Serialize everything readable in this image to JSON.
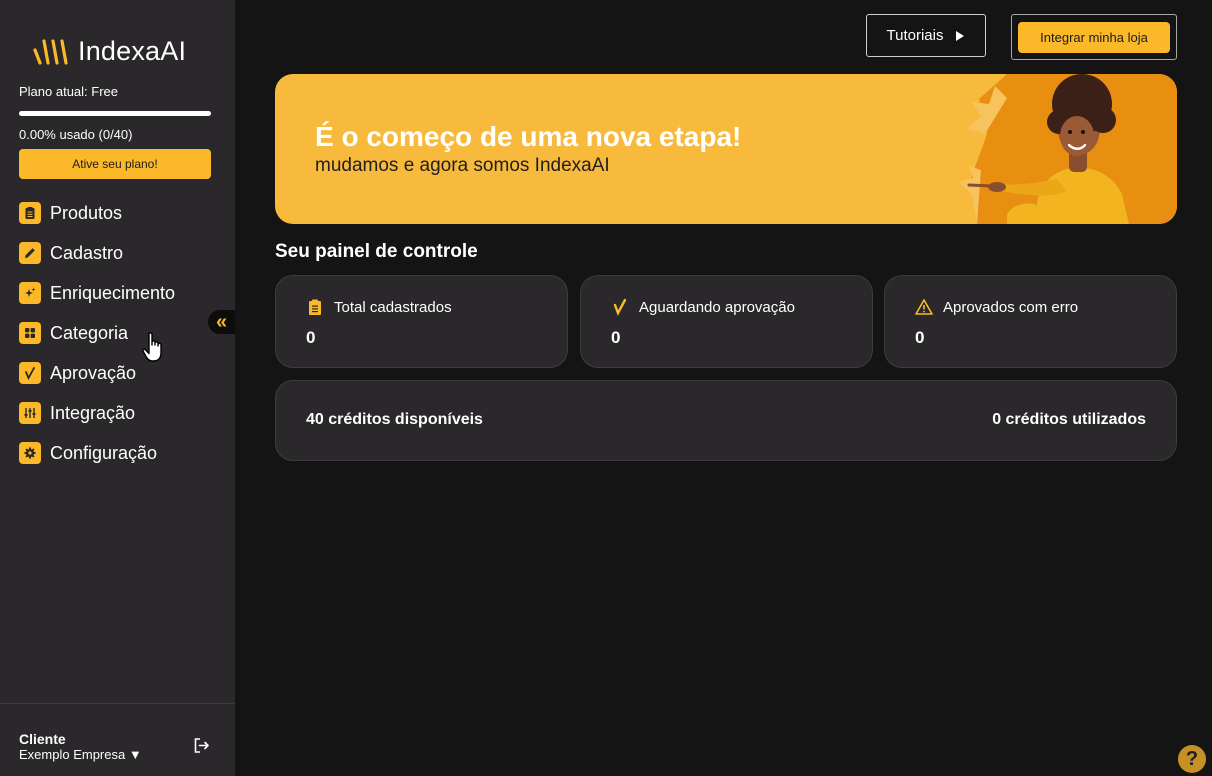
{
  "brand": {
    "name": "IndexaAI",
    "accent": "#fbb829"
  },
  "plan": {
    "label": "Plano atual: Free",
    "usage_fraction": 0.0,
    "usage_label": "0.00% usado (0/40)",
    "activate_label": "Ative seu plano!"
  },
  "nav": {
    "items": [
      {
        "label": "Produtos",
        "icon": "clipboard-icon"
      },
      {
        "label": "Cadastro",
        "icon": "pencil-icon"
      },
      {
        "label": "Enriquecimento",
        "icon": "sparkle-icon"
      },
      {
        "label": "Categoria",
        "icon": "grid-icon"
      },
      {
        "label": "Aprovação",
        "icon": "check-icon"
      },
      {
        "label": "Integração",
        "icon": "sliders-icon"
      },
      {
        "label": "Configuração",
        "icon": "gear-icon"
      }
    ],
    "collapse_glyph": "«"
  },
  "footer": {
    "client_label": "Cliente",
    "client_name": "Exemplo Empresa ▼"
  },
  "header": {
    "tutorials_label": "Tutoriais",
    "integrate_label": "Integrar minha loja"
  },
  "banner": {
    "title": "É o começo de uma nova etapa!",
    "subtitle": "mudamos e agora somos IndexaAI"
  },
  "dashboard": {
    "title": "Seu painel de controle",
    "stats": [
      {
        "label": "Total cadastrados",
        "value": "0",
        "icon": "clipboard-icon"
      },
      {
        "label": "Aguardando aprovação",
        "value": "0",
        "icon": "check-icon"
      },
      {
        "label": "Aprovados com erro",
        "value": "0",
        "icon": "warning-icon"
      }
    ],
    "credits_available": "40 créditos disponíveis",
    "credits_used": "0 créditos utilizados"
  },
  "help": {
    "glyph": "?"
  }
}
